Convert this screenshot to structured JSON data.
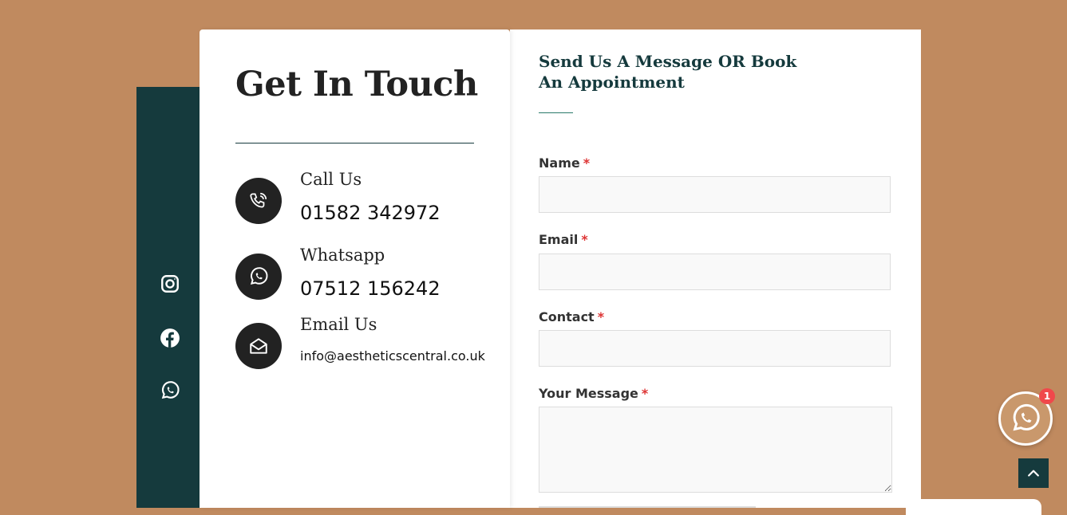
{
  "colors": {
    "background": "#c08a5f",
    "dark_teal": "#153a3d",
    "required_star": "#d33",
    "badge": "#f0484b",
    "floating_button": "#c9986c"
  },
  "social": {
    "items": [
      {
        "name": "instagram-icon"
      },
      {
        "name": "facebook-icon"
      },
      {
        "name": "whatsapp-icon"
      }
    ]
  },
  "contact": {
    "title": "Get In Touch",
    "items": [
      {
        "label": "Call Us",
        "value": "01582 342972",
        "icon": "phone-icon"
      },
      {
        "label": "Whatsapp",
        "value": "07512 156242",
        "icon": "whatsapp-icon"
      },
      {
        "label": "Email Us",
        "value": "info@aestheticscentral.co.uk",
        "icon": "envelope-open-icon"
      }
    ]
  },
  "form": {
    "heading": "Send Us A Message OR Book An Appointment",
    "required_marker": "*",
    "fields": {
      "name": {
        "label": "Name",
        "value": ""
      },
      "email": {
        "label": "Email",
        "value": ""
      },
      "contact": {
        "label": "Contact",
        "value": ""
      },
      "message": {
        "label": "Your Message",
        "value": ""
      }
    }
  },
  "floating": {
    "whatsapp_icon": "whatsapp-icon",
    "badge_count": "1",
    "scroll_top_icon": "chevron-up-icon"
  }
}
